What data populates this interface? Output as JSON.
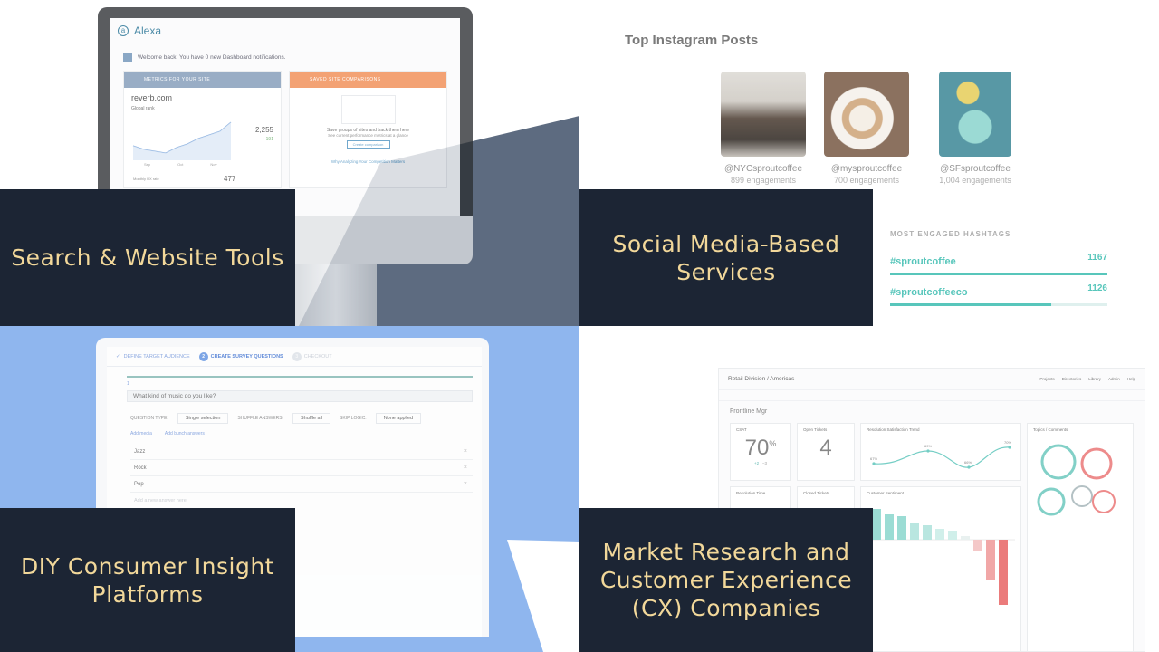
{
  "panels": {
    "search": {
      "label": "Search & Website Tools"
    },
    "social": {
      "label": "Social Media-Based Services"
    },
    "diy": {
      "label": "DIY Consumer Insight Platforms"
    },
    "market": {
      "label": "Market Research and Customer Experience (CX) Companies"
    }
  },
  "alexa": {
    "logo": "Alexa",
    "logo_mark": "a",
    "welcome": "Welcome back! You have 0 new Dashboard notifications.",
    "card1_title": "METRICS FOR YOUR SITE",
    "card2_title": "SAVED SITE COMPARISONS",
    "site": "reverb.com",
    "manage": "Manage",
    "global_rank": "Global rank",
    "rank_value": "2,255",
    "rank_change": "+ 191",
    "months": [
      "Sep",
      "Oct",
      "Nov"
    ],
    "monthly_label": "Monthly UX rate",
    "monthly_value": "477",
    "save_title": "Save groups of sites and track them here",
    "save_sub": "See current performance metrics at a glance",
    "create_button": "Create comparison",
    "analyze_link": "Why Analyzing Your Competition Matters"
  },
  "instagram": {
    "title": "Top Instagram Posts",
    "posts": [
      {
        "handle": "@NYCsproutcoffee",
        "engagements": "899 engagements"
      },
      {
        "handle": "@mysproutcoffee",
        "engagements": "700 engagements"
      },
      {
        "handle": "@SFsproutcoffee",
        "engagements": "1,004 engagements"
      }
    ],
    "hashtags_title": "MOST ENGAGED HASHTAGS",
    "hashtags": [
      {
        "tag": "#sproutcoffee",
        "count": "1167",
        "fill": 1.0
      },
      {
        "tag": "#sproutcoffeeco",
        "count": "1126",
        "fill": 0.74
      }
    ]
  },
  "survey": {
    "steps": [
      {
        "label": "DEFINE TARGET AUDIENCE",
        "mark": "✓"
      },
      {
        "label": "CREATE SURVEY QUESTIONS",
        "mark": "2"
      },
      {
        "label": "CHECKOUT",
        "mark": "3"
      }
    ],
    "question": "What kind of music do you like?",
    "question_number": "1",
    "question_type_label": "QUESTION TYPE:",
    "question_type_value": "Single selection",
    "shuffle_label": "SHUFFLE ANSWERS:",
    "shuffle_value": "Shuffle all",
    "skip_label": "SKIP LOGIC:",
    "skip_value": "None applied",
    "add_media": "Add media",
    "add_bunch": "Add bunch answers",
    "answers": [
      "Jazz",
      "Rock",
      "Pop"
    ],
    "add_answer_placeholder": "Add a new answer here"
  },
  "cx": {
    "breadcrumb": "Retail Division / Americas",
    "nav": [
      "Projects",
      "Directories",
      "Library",
      "Admin",
      "Help"
    ],
    "role": "Frontline Mgr",
    "csat_label": "CSAT",
    "csat_value": "70",
    "csat_unit": "%",
    "csat_change_1": "+2",
    "csat_change_2": "−3",
    "open_tickets_label": "Open Tickets",
    "open_tickets_value": "4",
    "trend_label": "Resolution Satisfaction Trend",
    "trend_points": [
      "67%",
      "69%",
      "66%",
      "70%"
    ],
    "topics_label": "Topics / Comments",
    "resolution_time_label": "Resolution Time",
    "closed_tickets_label": "Closed Tickets",
    "sentiment_label": "Customer Sentiment",
    "sentiment_bars": [
      "Checkout",
      "Price",
      "Selection",
      "Product Quality",
      "Accessories",
      "Warranty",
      "Wait Time",
      "Product Availability",
      "Staff Helpfulness",
      "Returns"
    ]
  }
}
